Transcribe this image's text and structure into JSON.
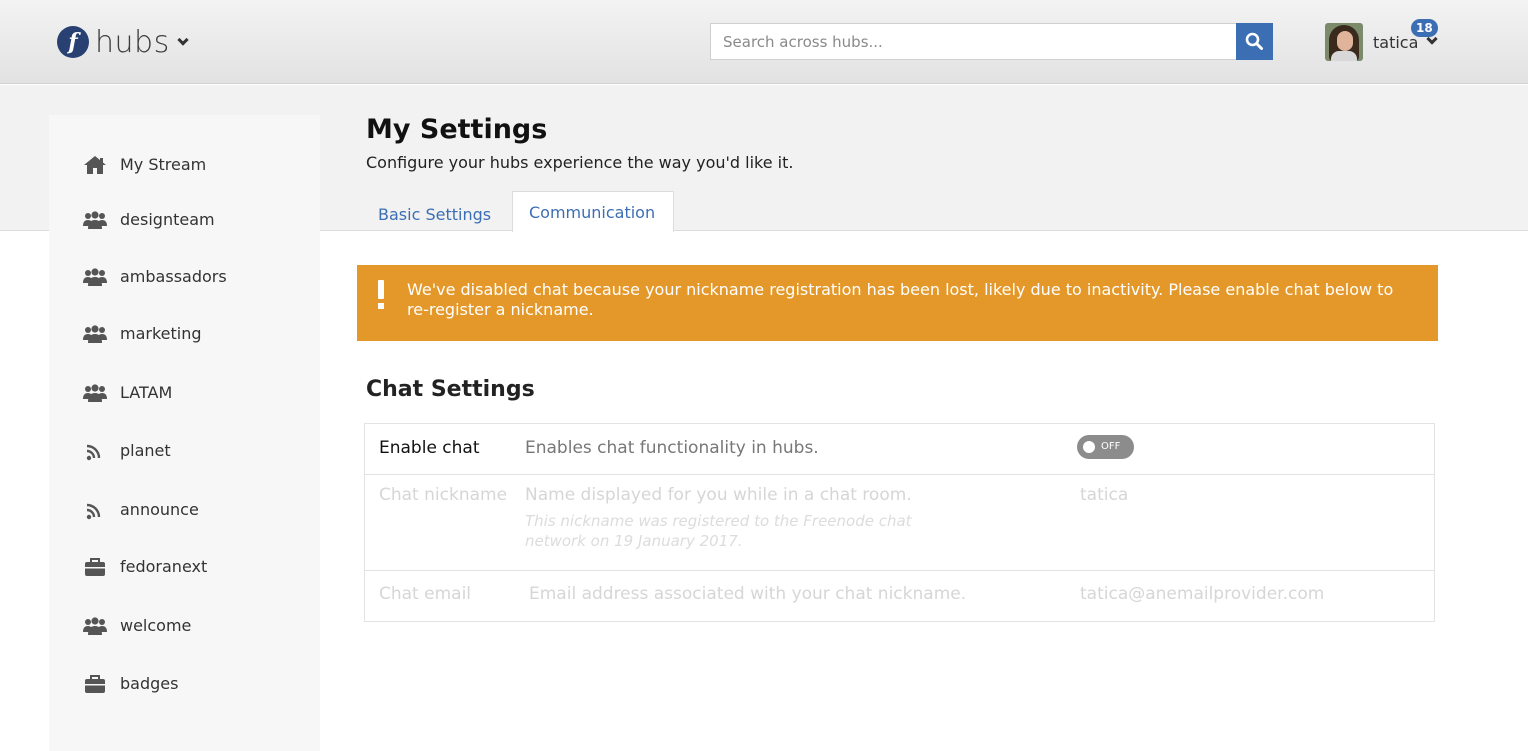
{
  "header": {
    "brand": "hubs",
    "search_placeholder": "Search across hubs...",
    "user_name": "tatica",
    "notification_count": "18"
  },
  "sidebar": {
    "items": [
      {
        "label": "My Stream",
        "icon": "home-icon"
      },
      {
        "label": "designteam",
        "icon": "group-icon"
      },
      {
        "label": "ambassadors",
        "icon": "group-icon"
      },
      {
        "label": "marketing",
        "icon": "group-icon"
      },
      {
        "label": "LATAM",
        "icon": "group-icon"
      },
      {
        "label": "planet",
        "icon": "rss-icon"
      },
      {
        "label": "announce",
        "icon": "rss-icon"
      },
      {
        "label": "fedoranext",
        "icon": "briefcase-icon"
      },
      {
        "label": "welcome",
        "icon": "group-icon"
      },
      {
        "label": "badges",
        "icon": "briefcase-icon"
      }
    ]
  },
  "main": {
    "title": "My Settings",
    "subtitle": "Configure your hubs experience the way you'd like it.",
    "tabs": [
      {
        "label": "Basic Settings",
        "active": false
      },
      {
        "label": "Communication",
        "active": true
      }
    ],
    "alert": "We've disabled chat because your nickname registration has been lost, likely due to inactivity. Please enable chat below to re-register a nickname.",
    "section_title": "Chat Settings",
    "settings": {
      "enable_chat": {
        "name": "Enable chat",
        "description": "Enables chat functionality in hubs.",
        "state": "OFF"
      },
      "chat_nickname": {
        "name": "Chat nickname",
        "description": "Name displayed for you while in a chat room.",
        "note": "This nickname was registered to the Freenode chat network on 19 January 2017.",
        "value": "tatica"
      },
      "chat_email": {
        "name": "Chat email",
        "description": "Email address associated with your chat nickname.",
        "value": "tatica@anemailprovider.com"
      }
    }
  },
  "colors": {
    "accent": "#3c6eb4",
    "alert": "#e5982a",
    "fedora_blue": "#294172"
  }
}
